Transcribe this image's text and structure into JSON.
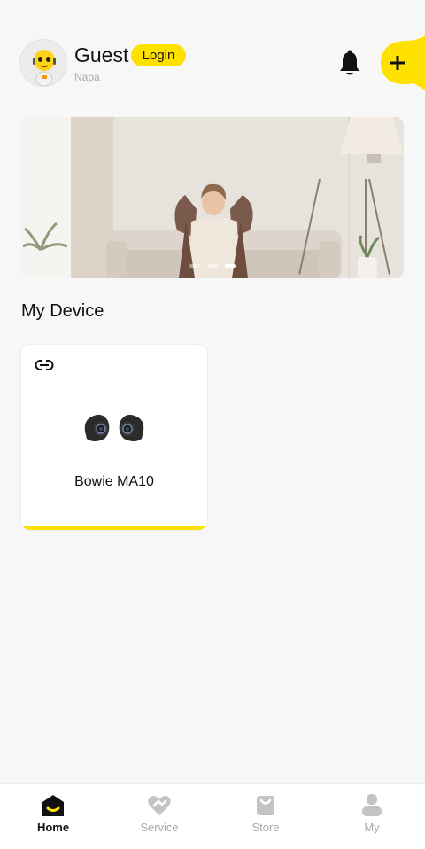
{
  "header": {
    "user_name": "Guest",
    "login_label": "Login",
    "location": "Napa",
    "bell_icon": "bell-icon",
    "add_icon": "plus-icon"
  },
  "banner": {
    "slide_count": 3,
    "active_slide": 3
  },
  "section_title": "My Device",
  "devices": [
    {
      "name": "Bowie MA10",
      "link_icon": "link-icon",
      "image": "earbuds-image"
    }
  ],
  "tabbar": {
    "tabs": [
      {
        "label": "Home",
        "icon": "home-icon",
        "active": true
      },
      {
        "label": "Service",
        "icon": "service-icon",
        "active": false
      },
      {
        "label": "Store",
        "icon": "store-bag-icon",
        "active": false
      },
      {
        "label": "My",
        "icon": "profile-icon",
        "active": false
      }
    ]
  },
  "colors": {
    "accent": "#ffe100",
    "background": "#f7f7f7",
    "inactive_tab": "#aaaaaa"
  }
}
